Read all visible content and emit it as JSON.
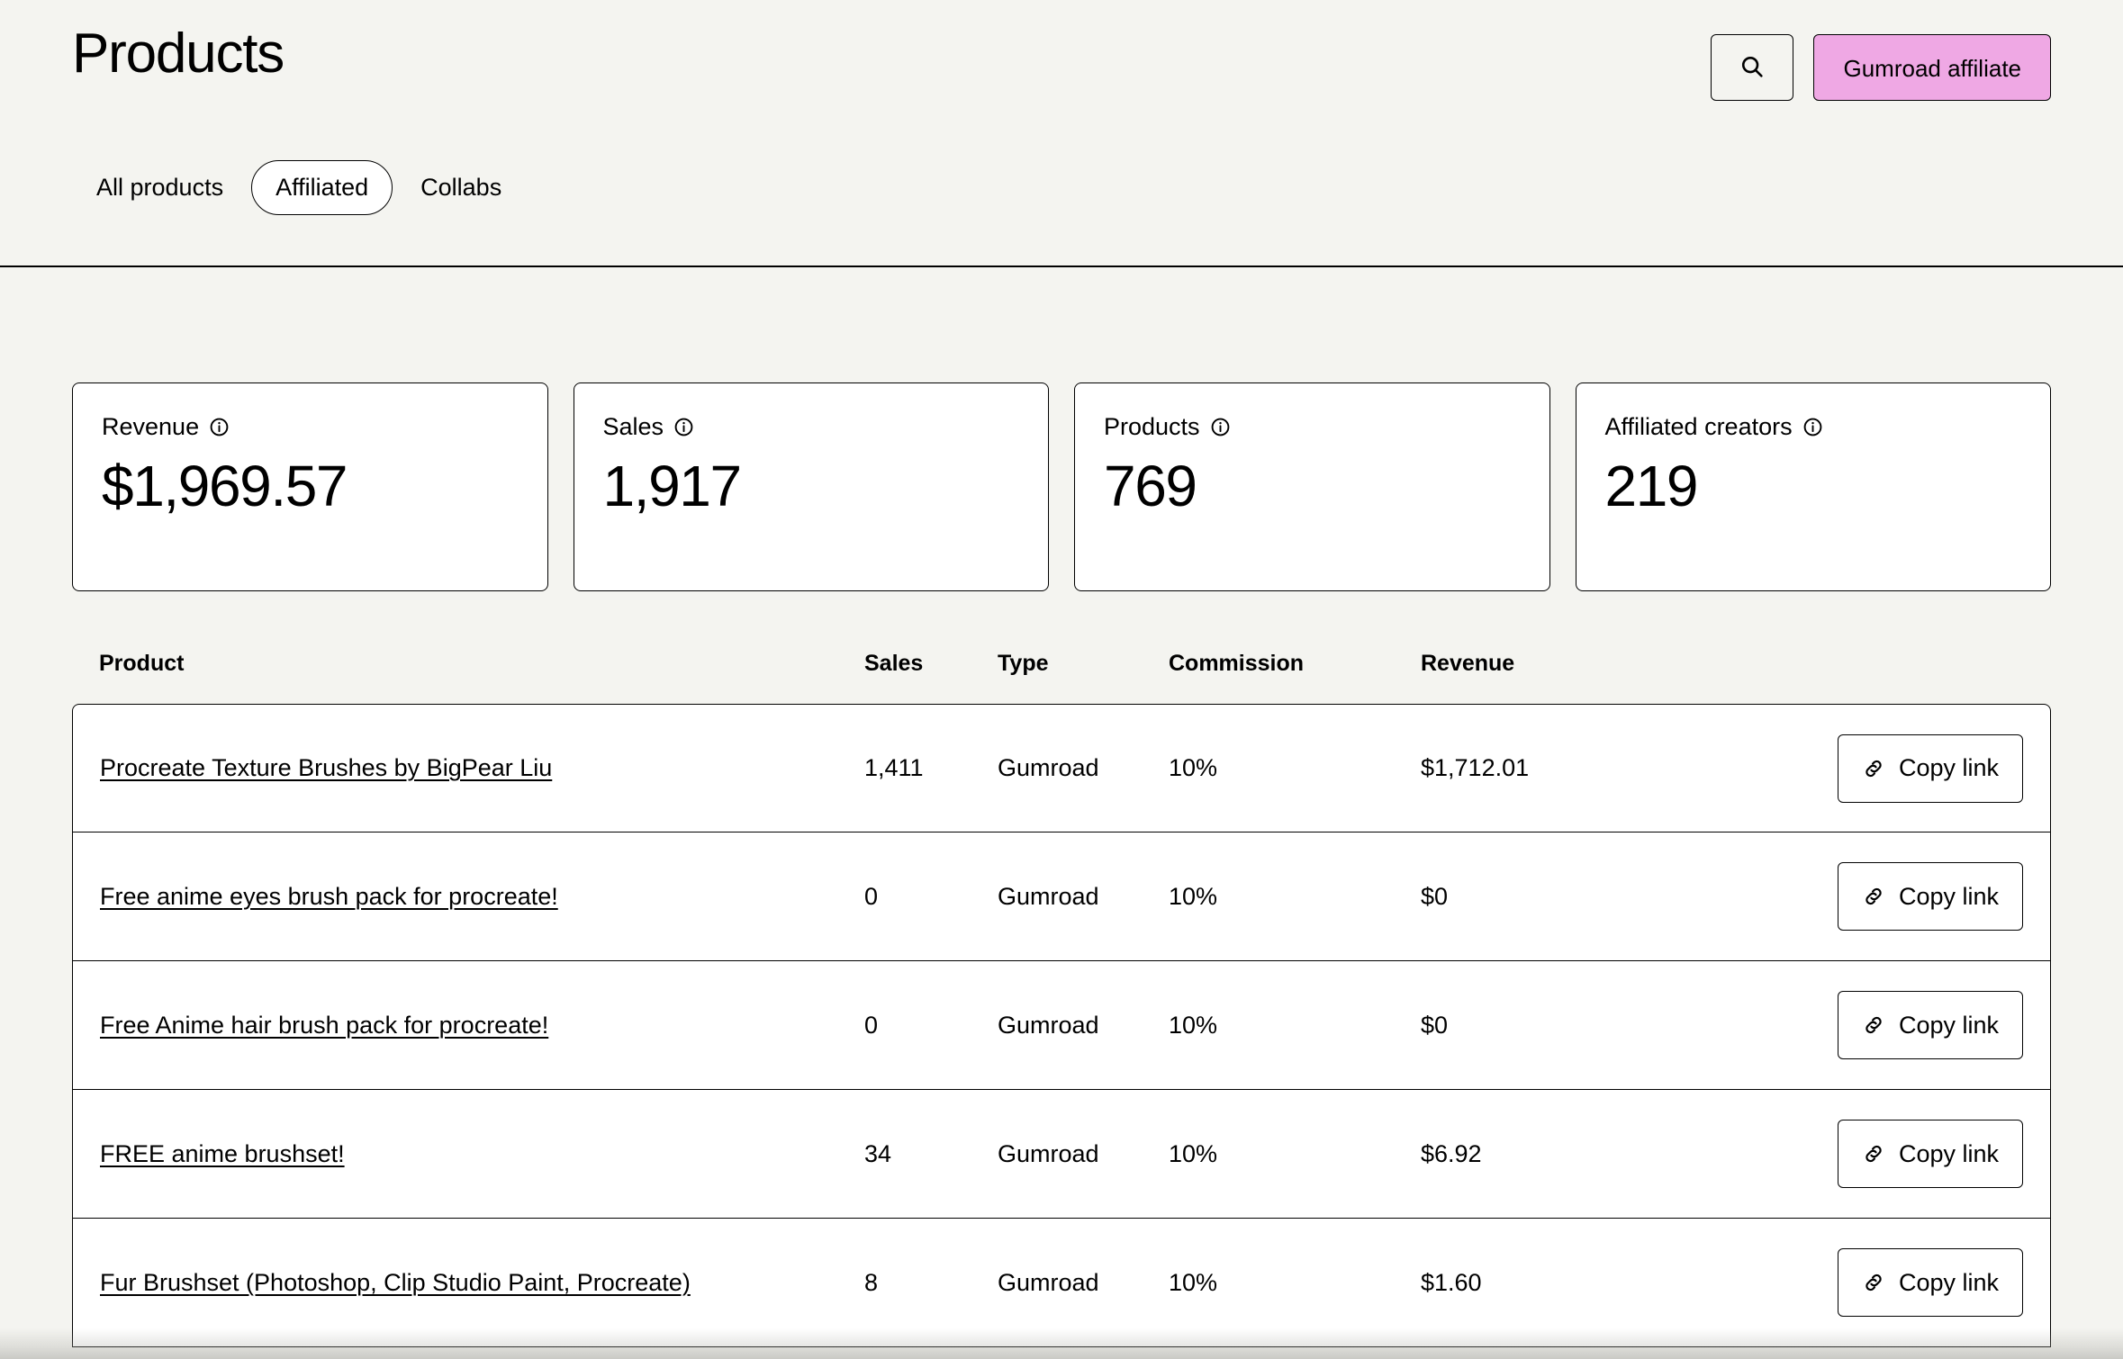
{
  "header": {
    "title": "Products",
    "search_icon": "search-icon",
    "affiliate_button": "Gumroad affiliate"
  },
  "tabs": [
    {
      "label": "All products",
      "active": false
    },
    {
      "label": "Affiliated",
      "active": true
    },
    {
      "label": "Collabs",
      "active": false
    }
  ],
  "stats": [
    {
      "label": "Revenue",
      "value": "$1,969.57",
      "info_icon": "info-icon"
    },
    {
      "label": "Sales",
      "value": "1,917",
      "info_icon": "info-icon"
    },
    {
      "label": "Products",
      "value": "769",
      "info_icon": "info-icon"
    },
    {
      "label": "Affiliated creators",
      "value": "219",
      "info_icon": "info-icon"
    }
  ],
  "table": {
    "columns": [
      "Product",
      "Sales",
      "Type",
      "Commission",
      "Revenue"
    ],
    "action_label": "Copy link",
    "action_icon": "link-icon",
    "rows": [
      {
        "product": "Procreate Texture Brushes by BigPear Liu",
        "sales": "1,411",
        "type": "Gumroad",
        "commission": "10%",
        "revenue": "$1,712.01",
        "action": "Copy link"
      },
      {
        "product": "Free anime eyes brush pack for procreate!",
        "sales": "0",
        "type": "Gumroad",
        "commission": "10%",
        "revenue": "$0",
        "action": "Copy link"
      },
      {
        "product": "Free Anime hair brush pack for procreate!",
        "sales": "0",
        "type": "Gumroad",
        "commission": "10%",
        "revenue": "$0",
        "action": "Copy link"
      },
      {
        "product": "FREE anime brushset!",
        "sales": "34",
        "type": "Gumroad",
        "commission": "10%",
        "revenue": "$6.92",
        "action": "Copy link"
      },
      {
        "product": "Fur Brushset (Photoshop, Clip Studio Paint, Procreate)",
        "sales": "8",
        "type": "Gumroad",
        "commission": "10%",
        "revenue": "$1.60",
        "action": "Copy link"
      }
    ]
  },
  "colors": {
    "page_background": "#F4F4F0",
    "surface": "#FFFFFF",
    "accent_pink": "#EFA8E4",
    "border": "#000000",
    "text": "#000000"
  }
}
